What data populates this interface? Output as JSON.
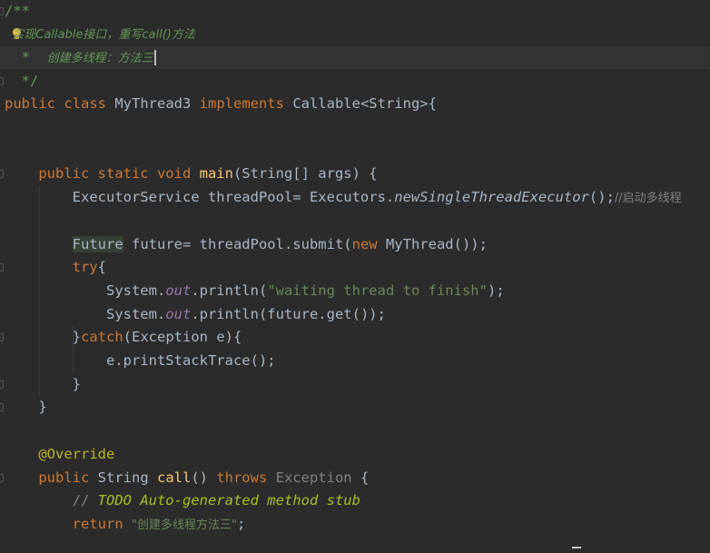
{
  "editor": {
    "lines": [
      {
        "tokens": [
          {
            "t": "/**",
            "c": "doc-tag"
          }
        ]
      },
      {
        "tokens": [
          {
            "t": "  实现Callable接口，重写call()方法",
            "c": "doc"
          }
        ],
        "bulb": true
      },
      {
        "tokens": [
          {
            "t": "  *  ",
            "c": "doc-tag"
          },
          {
            "t": "创建多线程：方法三",
            "c": "doc"
          }
        ],
        "current": true,
        "caret": true
      },
      {
        "tokens": [
          {
            "t": "  */",
            "c": "doc-tag"
          }
        ]
      },
      {
        "tokens": [
          {
            "t": "public class ",
            "c": "kw"
          },
          {
            "t": "MyThread3 ",
            "c": ""
          },
          {
            "t": "implements ",
            "c": "kw"
          },
          {
            "t": "Callable<String>{",
            "c": ""
          }
        ]
      },
      {
        "tokens": []
      },
      {
        "tokens": []
      },
      {
        "tokens": [
          {
            "t": "    public static void ",
            "c": "kw"
          },
          {
            "t": "main",
            "c": "fn"
          },
          {
            "t": "(String[] args) {",
            "c": ""
          }
        ]
      },
      {
        "tokens": [
          {
            "t": "        ExecutorService threadPool= Executors.",
            "c": ""
          },
          {
            "t": "newSingleThreadExecutor",
            "c": "static-call"
          },
          {
            "t": "();",
            "c": ""
          },
          {
            "t": "//启动多线程",
            "c": "cmt-grey"
          }
        ]
      },
      {
        "tokens": []
      },
      {
        "tokens": [
          {
            "t": "        ",
            "c": ""
          },
          {
            "t": "Future",
            "c": "hl"
          },
          {
            "t": " future= threadPool.submit(",
            "c": ""
          },
          {
            "t": "new ",
            "c": "kw"
          },
          {
            "t": "MyThread());",
            "c": ""
          }
        ]
      },
      {
        "tokens": [
          {
            "t": "        ",
            "c": ""
          },
          {
            "t": "try",
            "c": "kw"
          },
          {
            "t": "{",
            "c": ""
          }
        ]
      },
      {
        "tokens": [
          {
            "t": "            System.",
            "c": ""
          },
          {
            "t": "out",
            "c": "field"
          },
          {
            "t": ".println(",
            "c": ""
          },
          {
            "t": "\"waiting thread to finish\"",
            "c": "str"
          },
          {
            "t": ");",
            "c": ""
          }
        ]
      },
      {
        "tokens": [
          {
            "t": "            System.",
            "c": ""
          },
          {
            "t": "out",
            "c": "field"
          },
          {
            "t": ".println(future.get());",
            "c": ""
          }
        ]
      },
      {
        "tokens": [
          {
            "t": "        }",
            "c": ""
          },
          {
            "t": "catch",
            "c": "kw"
          },
          {
            "t": "(Exception e){",
            "c": ""
          }
        ]
      },
      {
        "tokens": [
          {
            "t": "            e.printStackTrace();",
            "c": ""
          }
        ]
      },
      {
        "tokens": [
          {
            "t": "        }",
            "c": ""
          }
        ]
      },
      {
        "tokens": [
          {
            "t": "    }",
            "c": ""
          }
        ]
      },
      {
        "tokens": []
      },
      {
        "tokens": [
          {
            "t": "    @Override",
            "c": "ann"
          }
        ]
      },
      {
        "tokens": [
          {
            "t": "    public ",
            "c": "kw"
          },
          {
            "t": "String ",
            "c": ""
          },
          {
            "t": "call",
            "c": "fn"
          },
          {
            "t": "() ",
            "c": ""
          },
          {
            "t": "throws ",
            "c": "kw"
          },
          {
            "t": "Exception",
            "c": "gray"
          },
          {
            "t": " {",
            "c": ""
          }
        ]
      },
      {
        "tokens": [
          {
            "t": "        // ",
            "c": "cmt-grey"
          },
          {
            "t": "TODO Auto-generated method stub",
            "c": "todo"
          }
        ]
      },
      {
        "tokens": [
          {
            "t": "        return ",
            "c": "kw"
          },
          {
            "t": "\"创建多线程方法三\"",
            "c": "str"
          },
          {
            "t": ";",
            "c": ""
          }
        ]
      }
    ]
  },
  "colors": {
    "background": "#2b2b2b",
    "keyword": "#cc7832",
    "function": "#ffc66d",
    "string": "#6a8759",
    "doc_comment": "#629755",
    "field": "#9876aa",
    "annotation": "#bbb529",
    "todo": "#a8c023"
  },
  "icons": [
    "intention-bulb-icon",
    "fold-marker-icon"
  ]
}
